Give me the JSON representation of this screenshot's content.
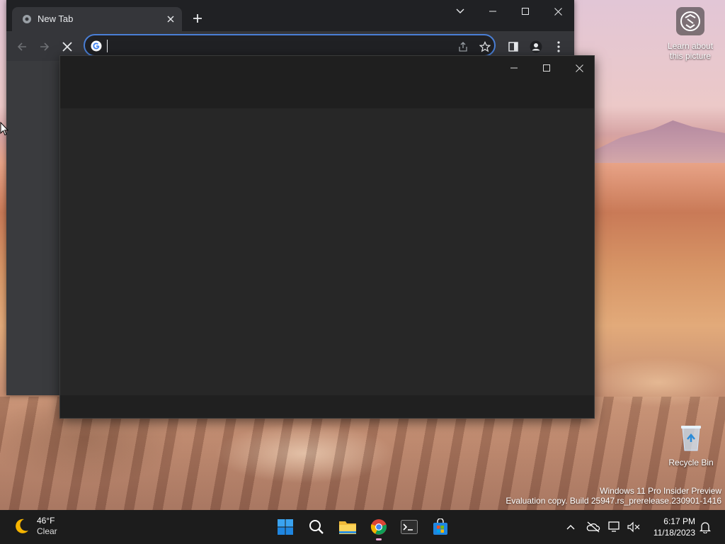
{
  "desktop": {
    "learn_label": "Learn about this picture",
    "recycle_label": "Recycle Bin",
    "watermark_line1": "Windows 11 Pro Insider Preview",
    "watermark_line2": "Evaluation copy. Build 25947.rs_prerelease.230901-1416"
  },
  "browser": {
    "tab_title": "New Tab",
    "omnibox_value": "",
    "accent_color": "#4a7fd6",
    "icons": [
      "back-icon",
      "forward-icon",
      "stop-loading-icon",
      "share-icon",
      "bookmark-star-icon",
      "side-panel-icon",
      "profile-icon",
      "more-menu-icon"
    ]
  },
  "taskbar": {
    "weather_temp": "46°F",
    "weather_condition": "Clear",
    "time": "6:17 PM",
    "date": "11/18/2023",
    "apps": [
      "start",
      "search",
      "file-explorer",
      "chrome",
      "terminal",
      "store"
    ]
  }
}
